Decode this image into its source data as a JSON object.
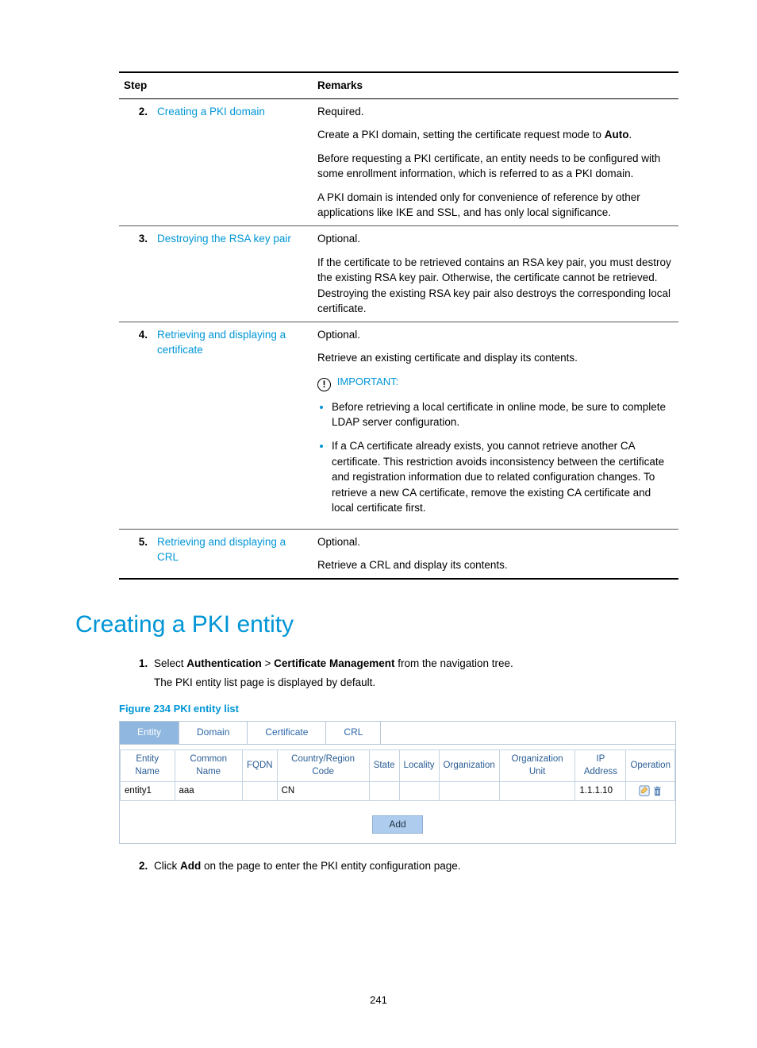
{
  "table": {
    "headers": {
      "step": "Step",
      "remarks": "Remarks"
    },
    "rows": [
      {
        "num": "2.",
        "title": "Creating a PKI domain",
        "p1": "Required.",
        "p2a": "Create a PKI domain, setting the certificate request mode to ",
        "p2b": "Auto",
        "p2c": ".",
        "p3": "Before requesting a PKI certificate, an entity needs to be configured with some enrollment information, which is referred to as a PKI domain.",
        "p4": "A PKI domain is intended only for convenience of reference by other applications like IKE and SSL, and has only local significance."
      },
      {
        "num": "3.",
        "title": "Destroying the RSA key pair",
        "p1": "Optional.",
        "p2": "If the certificate to be retrieved contains an RSA key pair, you must destroy the existing RSA key pair. Otherwise, the certificate cannot be retrieved. Destroying the existing RSA key pair also destroys the corresponding local certificate."
      },
      {
        "num": "4.",
        "title": "Retrieving and displaying a certificate",
        "p1": "Optional.",
        "p2": "Retrieve an existing certificate and display its contents.",
        "important": "IMPORTANT:",
        "b1": "Before retrieving a local certificate in online mode, be sure to complete LDAP server configuration.",
        "b2": "If a CA certificate already exists, you cannot retrieve another CA certificate. This restriction avoids inconsistency between the certificate and registration information due to related configuration changes. To retrieve a new CA certificate, remove the existing CA certificate and local certificate first."
      },
      {
        "num": "5.",
        "title": "Retrieving and displaying a CRL",
        "p1": "Optional.",
        "p2": "Retrieve a CRL and display its contents."
      }
    ]
  },
  "section_title": "Creating a PKI entity",
  "proc": {
    "step1a": "Select ",
    "step1b": "Authentication",
    "step1c": " > ",
    "step1d": "Certificate Management",
    "step1e": " from the navigation tree.",
    "step1_sub": "The PKI entity list page is displayed by default.",
    "step2a": "Click ",
    "step2b": "Add",
    "step2c": " on the page to enter the PKI entity configuration page."
  },
  "figure": {
    "caption": "Figure 234 PKI entity list",
    "tabs": [
      "Entity",
      "Domain",
      "Certificate",
      "CRL"
    ],
    "headers": [
      "Entity Name",
      "Common Name",
      "FQDN",
      "Country/Region Code",
      "State",
      "Locality",
      "Organization",
      "Organization Unit",
      "IP Address",
      "Operation"
    ],
    "row": {
      "entity_name": "entity1",
      "common_name": "aaa",
      "fqdn": "",
      "country": "CN",
      "state": "",
      "locality": "",
      "org": "",
      "org_unit": "",
      "ip": "1.1.1.10"
    },
    "add": "Add"
  },
  "page_number": "241"
}
